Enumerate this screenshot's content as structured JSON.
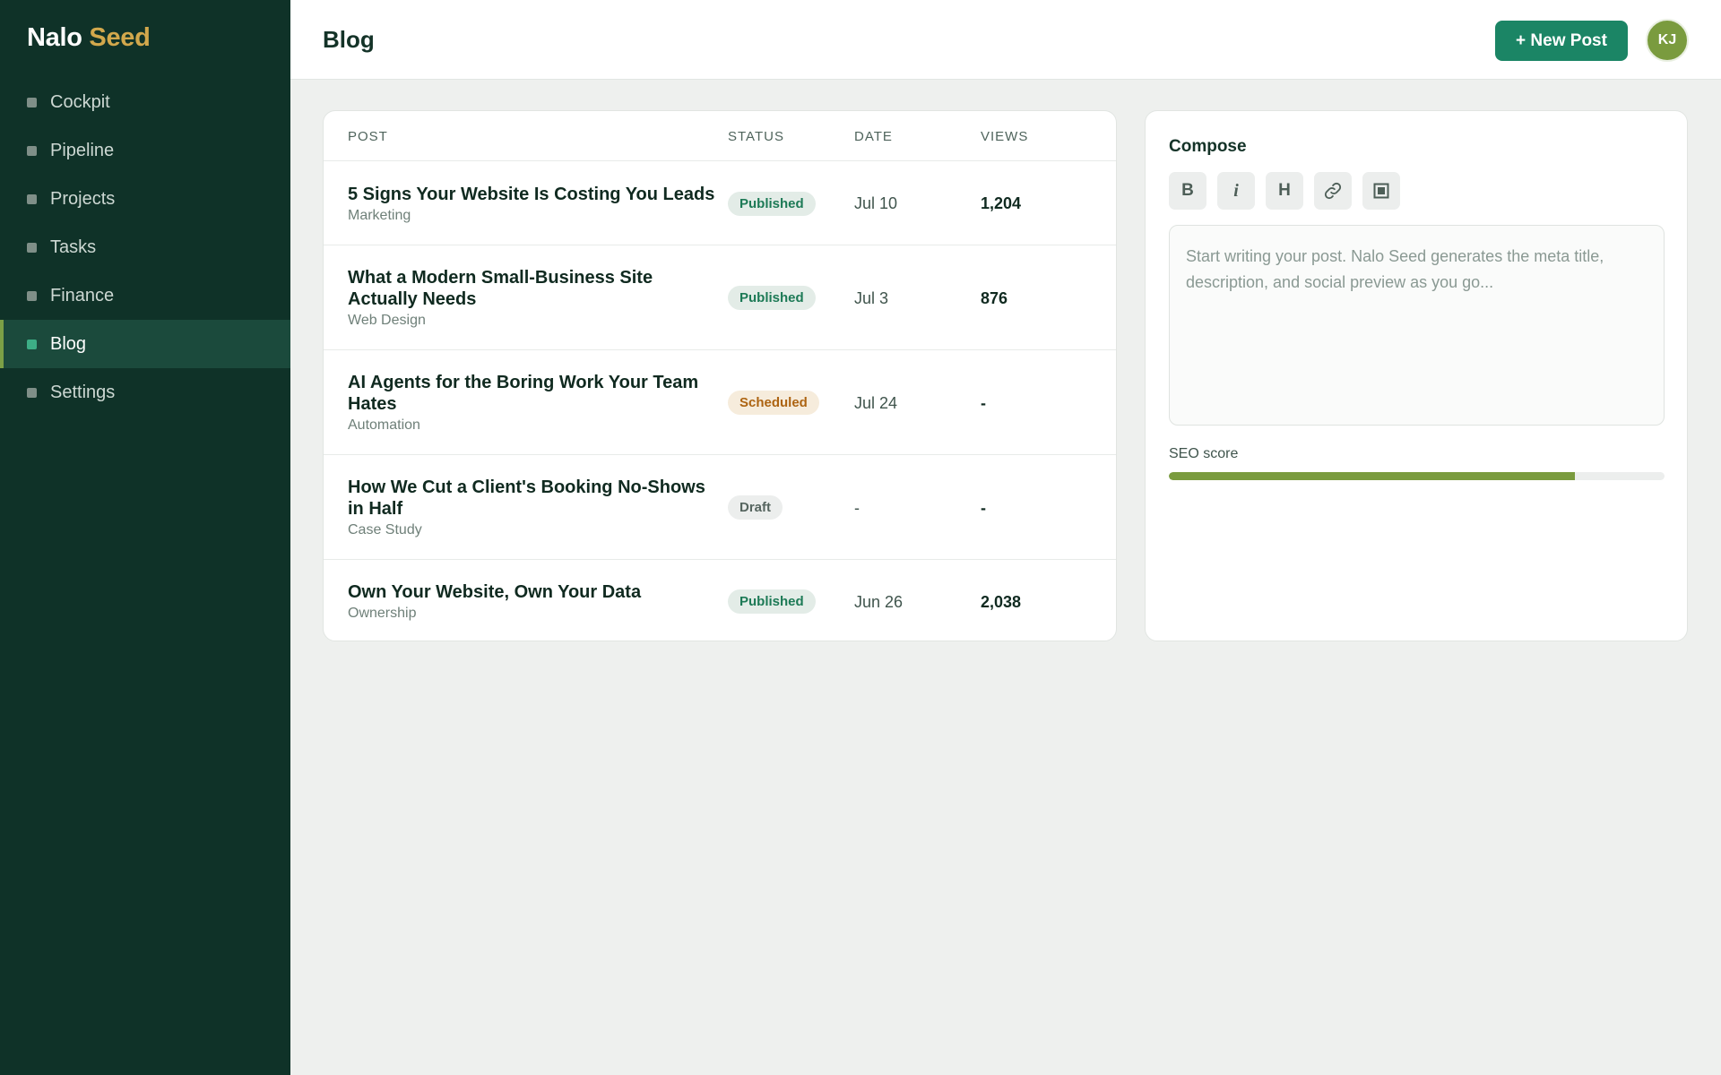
{
  "brand": {
    "part1": "Nalo",
    "part2": "Seed"
  },
  "sidebar": {
    "items": [
      {
        "label": "Cockpit",
        "active": false
      },
      {
        "label": "Pipeline",
        "active": false
      },
      {
        "label": "Projects",
        "active": false
      },
      {
        "label": "Tasks",
        "active": false
      },
      {
        "label": "Finance",
        "active": false
      },
      {
        "label": "Blog",
        "active": true
      },
      {
        "label": "Settings",
        "active": false
      }
    ]
  },
  "header": {
    "title": "Blog",
    "new_post_label": "+ New Post",
    "avatar_initials": "KJ"
  },
  "table": {
    "columns": [
      "POST",
      "STATUS",
      "DATE",
      "VIEWS"
    ],
    "rows": [
      {
        "title": "5 Signs Your Website Is Costing You Leads",
        "category": "Marketing",
        "status": "Published",
        "status_kind": "published",
        "date": "Jul 10",
        "views": "1,204"
      },
      {
        "title": "What a Modern Small-Business Site Actually Needs",
        "category": "Web Design",
        "status": "Published",
        "status_kind": "published",
        "date": "Jul 3",
        "views": "876"
      },
      {
        "title": "AI Agents for the Boring Work Your Team Hates",
        "category": "Automation",
        "status": "Scheduled",
        "status_kind": "scheduled",
        "date": "Jul 24",
        "views": "-"
      },
      {
        "title": "How We Cut a Client's Booking No-Shows in Half",
        "category": "Case Study",
        "status": "Draft",
        "status_kind": "draft",
        "date": "-",
        "views": "-"
      },
      {
        "title": "Own Your Website, Own Your Data",
        "category": "Ownership",
        "status": "Published",
        "status_kind": "published",
        "date": "Jun 26",
        "views": "2,038"
      }
    ]
  },
  "compose": {
    "title": "Compose",
    "toolbar": {
      "bold": "B",
      "italic": "i",
      "heading": "H",
      "link_icon": "link-icon",
      "image_icon": "image-icon"
    },
    "editor_placeholder": "Start writing your post. Nalo Seed generates the meta title, description, and social preview as you go...",
    "editor_value": "",
    "seo_label": "SEO score",
    "seo_score_fraction": 0.82
  },
  "colors": {
    "sidebar_bg": "#0f3228",
    "brand_accent": "#d2a84c",
    "primary": "#1b8565",
    "seo_bar": "#7a9b3e",
    "published": "#1d7a56",
    "scheduled": "#ad6412",
    "draft": "#56655f"
  }
}
